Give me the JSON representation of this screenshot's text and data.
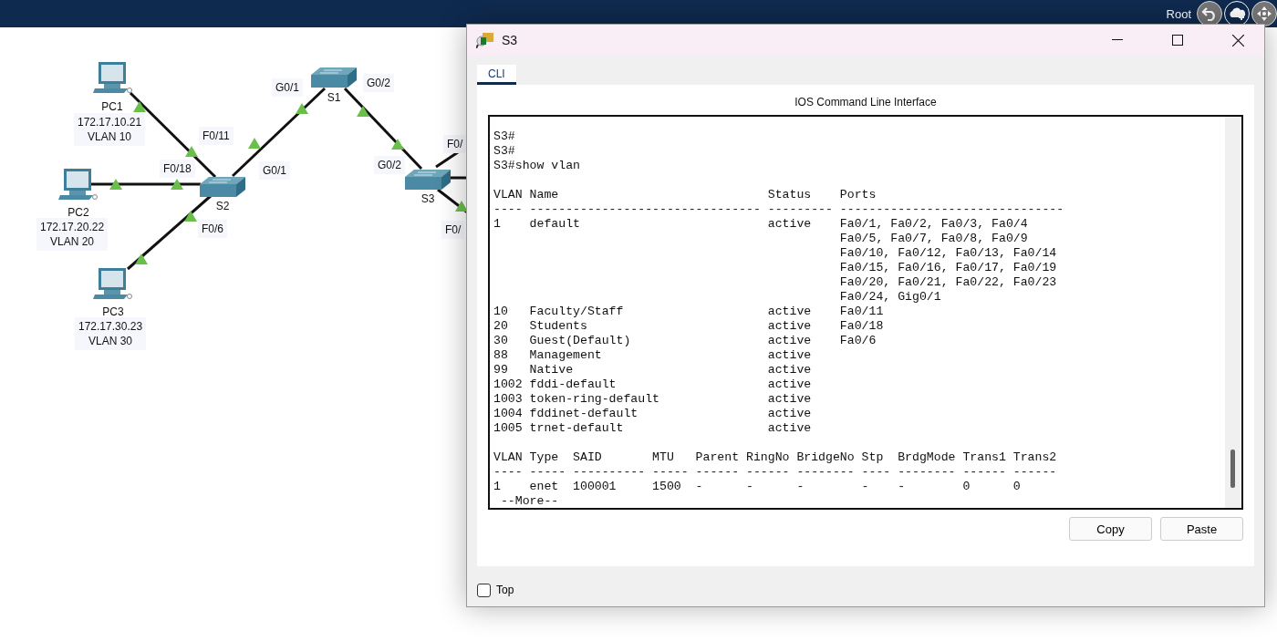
{
  "top_bar": {
    "user": "Root"
  },
  "topology": {
    "nodes": [
      {
        "kind": "pc",
        "name": "PC1",
        "ip": "172.17.10.21",
        "vlan": "VLAN 10"
      },
      {
        "kind": "pc",
        "name": "PC2",
        "ip": "172.17.20.22",
        "vlan": "VLAN 20"
      },
      {
        "kind": "pc",
        "name": "PC3",
        "ip": "172.17.30.23",
        "vlan": "VLAN 30"
      },
      {
        "kind": "switch",
        "name": "S2"
      },
      {
        "kind": "switch",
        "name": "S1"
      },
      {
        "kind": "switch",
        "name": "S3"
      }
    ],
    "port_labels": [
      "F0/11",
      "F0/18",
      "F0/6",
      "G0/1",
      "G0/1",
      "G0/2",
      "G0/2",
      "F0/",
      "F0/"
    ]
  },
  "window": {
    "title": "S3",
    "tabs": [
      {
        "label": "CLI",
        "selected": true
      }
    ],
    "heading": "IOS Command Line Interface",
    "terminal_blocks": [
      [
        "S3#",
        "S3#",
        "S3#show vlan"
      ],
      [
        "VLAN Name                             Status    Ports",
        "---- -------------------------------- --------- -------------------------------",
        "1    default                          active    Fa0/1, Fa0/2, Fa0/3, Fa0/4",
        "                                                Fa0/5, Fa0/7, Fa0/8, Fa0/9",
        "                                                Fa0/10, Fa0/12, Fa0/13, Fa0/14",
        "                                                Fa0/15, Fa0/16, Fa0/17, Fa0/19",
        "                                                Fa0/20, Fa0/21, Fa0/22, Fa0/23",
        "                                                Fa0/24, Gig0/1",
        "10   Faculty/Staff                    active    Fa0/11",
        "20   Students                         active    Fa0/18",
        "30   Guest(Default)                   active    Fa0/6",
        "88   Management                       active",
        "99   Native                           active",
        "1002 fddi-default                     active",
        "1003 token-ring-default               active",
        "1004 fddinet-default                  active",
        "1005 trnet-default                    active"
      ],
      [
        "VLAN Type  SAID       MTU   Parent RingNo BridgeNo Stp  BrdgMode Trans1 Trans2",
        "---- ----- ---------- ----- ------ ------ -------- ---- -------- ------ ------",
        "1    enet  100001     1500  -      -      -        -    -        0      0",
        " --More--"
      ]
    ],
    "buttons": [
      "Copy",
      "Paste"
    ],
    "top_checkbox": {
      "label": "Top",
      "checked": false
    }
  }
}
